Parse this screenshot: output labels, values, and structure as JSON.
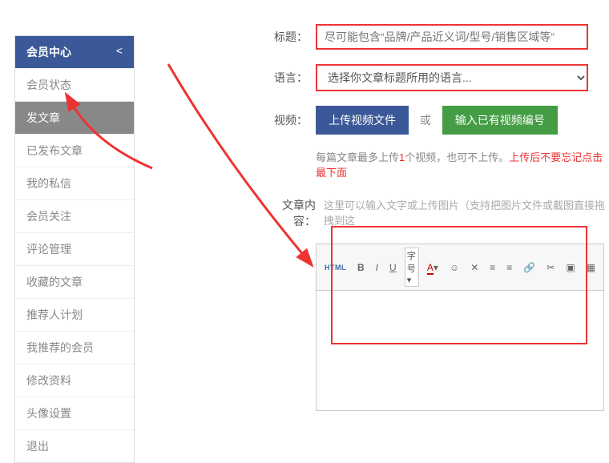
{
  "sidebar": {
    "title": "会员中心",
    "chevron": "<",
    "items": [
      {
        "label": "会员状态"
      },
      {
        "label": "发文章"
      },
      {
        "label": "已发布文章"
      },
      {
        "label": "我的私信"
      },
      {
        "label": "会员关注"
      },
      {
        "label": "评论管理"
      },
      {
        "label": "收藏的文章"
      },
      {
        "label": "推荐人计划"
      },
      {
        "label": "我推荐的会员"
      },
      {
        "label": "修改资料"
      },
      {
        "label": "头像设置"
      },
      {
        "label": "退出"
      }
    ]
  },
  "form": {
    "title_label": "标题：",
    "title_placeholder": "尽可能包含“品牌/产品近义词/型号/销售区域等”",
    "lang_label": "语言：",
    "lang_placeholder": "选择你文章标题所用的语言...",
    "video_label": "视频：",
    "upload_btn": "上传视频文件",
    "or_text": "或",
    "existing_btn": "输入已有视频编号",
    "note_prefix": "每篇文章最多上传",
    "note_count": "1",
    "note_mid": "个视频，也可不上传。",
    "note_warn": "上传后不要忘记点击最下面",
    "content_label": "文章内容：",
    "content_hint": "这里可以输入文字或上传图片（支持把图片文件或截图直接拖拽到这"
  },
  "toolbar": {
    "html": "HTML",
    "bold": "B",
    "italic": "I",
    "underline": "U",
    "fontsize": "字号",
    "fontsize_arrow": "▾",
    "color_a": "A",
    "color_arrow": "▾"
  }
}
